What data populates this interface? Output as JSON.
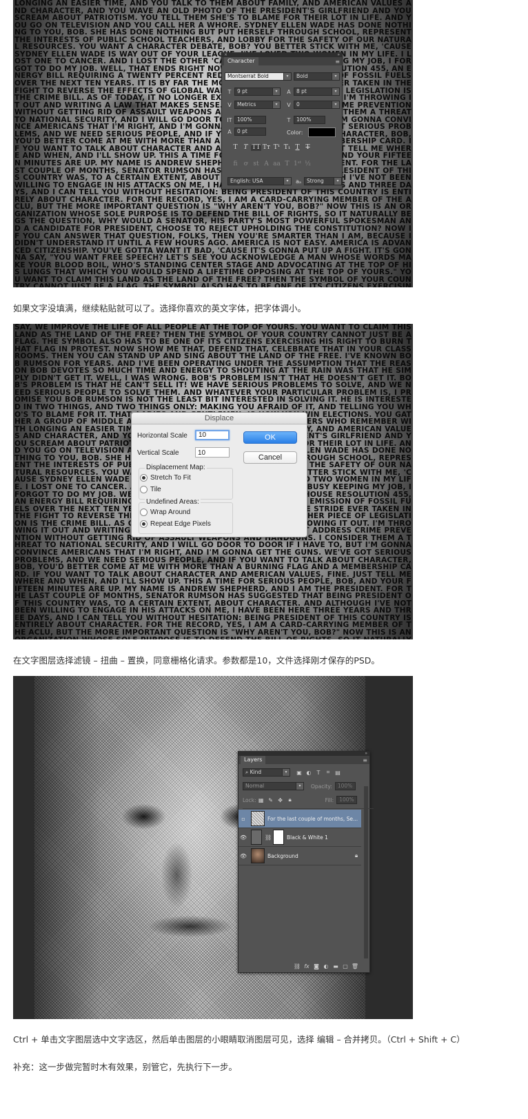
{
  "figure1": {
    "art_text": "LONGING AN EASIER TIME, AND YOU TALK TO THEM ABOUT FAMILY, AND AMERICAN VALUES AND CHARACTER, AND YOU WAVE AN OLD PHOTO OF THE PRESIDENT'S GIRLFRIEND AND YOU SCREAM ABOUT PATRIOTISM. YOU TELL THEM SHE'S TO BLAME FOR THEIR LOT IN LIFE. AND YOU GO ON TELEVISION AND YOU CALL HER A WHORE. SYDNEY ELLEN WADE HAS DONE NOTHING TO YOU, BOB. SHE HAS DONE NOTHING BUT PUT HERSELF THROUGH SCHOOL, REPRESENT THE INTERESTS OF PUBLIC SCHOOL TEACHERS, AND LOBBY FOR THE SAFETY OF OUR NATURAL RESOURCES. YOU WANT A CHARACTER DEBATE, BOB? YOU BETTER STICK WITH ME, 'CAUSE SYDNEY ELLEN WADE IS WAY OUT OF YOUR LEAGUE. I'VE LOVED TWO WOMEN IN MY LIFE. I LOST ONE TO CANCER. AND I LOST THE OTHER 'CAUSE I WAS SO BUSY KEEPING MY JOB, I FORGOT TO DO MY JOB. WELL, THAT ENDS RIGHT NOW. IT'S WHITE HOUSE RESOLUTION 455, AN ENERGY BILL REQUIRING A TWENTY PERCENT REDUCTION OF THE EMISSION OF FOSSIL FUELS OVER THE NEXT TEN YEARS. IT IS BY FAR THE MOST AGGRESSIVE STRIDE EVER TAKEN IN THE FIGHT TO REVERSE THE EFFECTS OF GLOBAL WARMING. THE OTHER PIECE OF LEGISLATION IS THE CRIME BILL. AS OF TODAY, IT NO LONGER EXISTS. I'M THROWING IT OUT. I'M THROWING IT OUT AND WRITING A LAW THAT MAKES SENSE. YOU CANNOT ADDRESS CRIME PREVENTION WITHOUT GETTING RID OF ASSAULT WEAPONS AND HANDGUNS. I CONSIDER THEM A THREAT TO NATIONAL SECURITY, AND I WILL GO DOOR TO DOOR IF I HAVE TO, BUT I'M GONNA CONVINCE AMERICANS THAT I'M RIGHT, AND I'M GONNA GET THE GUNS. WE'VE GOT SERIOUS PROBLEMS, AND WE NEED SERIOUS PEOPLE, AND IF YOU WANT TO TALK ABOUT CHARACTER, BOB, YOU'D BETTER COME AT ME WITH MORE THAN A BURNING FLAG AND A MEMBERSHIP CARD. IF YOU WANT TO TALK ABOUT CHARACTER AND AMERICAN VALUES, FINE. JUST TELL ME WHERE AND WHEN, AND I'LL SHOW UP. THIS A TIME FOR SERIOUS PEOPLE, BOB, AND YOUR FIFTEEN MINUTES ARE UP. MY NAME IS ANDREW SHEPHERD, AND I AM THE PRESIDENT. FOR THE LAST COUPLE OF MONTHS, SENATOR RUMSON HAS SUGGESTED THAT BEING PRESIDENT OF THIS COUNTRY WAS, TO A CERTAIN EXTENT, ABOUT CHARACTER. AND ALTHOUGH I'VE NOT BEEN WILLING TO ENGAGE IN HIS ATTACKS ON ME, I HAVE BEEN HERE THREE YEARS AND THREE DAYS, AND I CAN TELL YOU WITHOUT HESITATION: BEING PRESIDENT OF THIS COUNTRY IS ENTIRELY ABOUT CHARACTER. FOR THE RECORD, YES, I AM A CARD-CARRYING MEMBER OF THE ACLU, BUT THE MORE IMPORTANT QUESTION IS \"WHY AREN'T YOU, BOB?\" NOW THIS IS AN ORGANIZATION WHOSE SOLE PURPOSE IS TO DEFEND THE BILL OF RIGHTS, SO IT NATURALLY BEGS THE QUESTION, WHY WOULD A SENATOR, HIS PARTY'S MOST POWERFUL SPOKESMAN AND A CANDIDATE FOR PRESIDENT, CHOOSE TO REJECT UPHOLDING THE CONSTITUTION? NOW IF YOU CAN ANSWER THAT QUESTION, FOLKS, THEN YOU'RE SMARTER THAN I AM, BECAUSE I DIDN'T UNDERSTAND IT UNTIL A FEW HOURS AGO. AMERICA IS NOT EASY. AMERICA IS ADVANCED CITIZENSHIP. YOU'VE GOTTA WANT IT BAD, 'CAUSE IT'S GONNA PUT UP A FIGHT. IT'S GONNA SAY, \"YOU WANT FREE SPEECH? LET'S SEE YOU ACKNOWLEDGE A MAN WHOSE WORDS MAKE YOUR BLOOD BOIL, WHO'S STANDING CENTER STAGE AND ADVOCATING AT THE TOP OF HIS LUNGS THAT WHICH YOU WOULD SPEND A LIFETIME OPPOSING AT THE TOP OF YOURS.\" YOU WANT TO CLAIM THIS LAND AS THE LAND OF THE FREE? THEN THE SYMBOL OF YOUR COUNTRY CANNOT JUST BE A FLAG. THE SYMBOL ALSO HAS TO BE ONE OF ITS CITIZENS EXERCISING HIS RIGHT TO BURN THAT FLAG IN PROTEST. NOW SHOW ME THAT, DEFEND THAT, CELEBRATE THAT IN YOUR CLASSROOMS. THEN YOU CAN STAND UP AND SING ABOUT THE LAND OF THE FREE. I'VE KNOWN BOB RUMSON FOR YEARS. AND I'VE BEEN OPERATING UNDER THE ASSUMPTION THAT THE REASON BOB DEVOTES SO MUCH TIME AND ENERGY TO SHOUTING AT THE RAIN WAS THAT HE SIMPLY DIDN'T GET IT. WELL, I WAS WRONG. BOB'S PROBLEM ISN'T THAT HE DOESN'T GET IT. BOB'S PROBLEM IS THAT HE CAN'T SELL IT! WE HAVE SERIOUS PROBLEMS TO SOLVE, AND WE NEED SERIOUS PEOPLE TO SOLVE THEM. AND WHATEVER YOUR PARTICULAR PROBLEM IS, I PROMISE YOU BOB RUMSON IS NOT THE LEAST BIT INTERESTED IN SOLVING IT. HE IS INTERESTED IN TWO THINGS, AND TWO THINGS ONLY: MAKING YOU AFRAID OF IT, AND TELLING YOU WHO'S TO BLAME FOR IT. THAT, LADIES AND GENTLEMEN, IS HOW YOU WIN ELECTIONS.",
    "character_panel": {
      "tab": "Character",
      "font_family": "Montserrat Bold",
      "font_style": "Bold",
      "font_size": "9 pt",
      "leading": "8 pt",
      "kerning": "Metrics",
      "tracking": "0",
      "vertical_scale": "100%",
      "horizontal_scale": "100%",
      "baseline_shift": "0 pt",
      "color_label": "Color:",
      "language": "English: USA",
      "aa_label": "aₐ",
      "antialias": "Strong"
    }
  },
  "caption1": "如果文字没填满，继续粘贴就可以了。选择你喜欢的英文字体，把字体调小。",
  "figure2": {
    "art_text": "SAY, WE IMPROVE THE LIFE OF ALL PEOPLE AT THE TOP OF YOURS. YOU WANT TO CLAIM THIS LAND AS THE LAND OF THE FREE? THEN THE SYMBOL OF YOUR COUNTRY CANNOT JUST BE A FLAG. THE SYMBOL ALSO HAS TO BE ONE OF ITS CITIZENS EXERCISING HIS RIGHT TO BURN THAT FLAG IN PROTEST. NOW SHOW ME THAT, DEFEND THAT, CELEBRATE THAT IN YOUR CLASSROOMS. THEN YOU CAN STAND UP AND SING ABOUT THE LAND OF THE FREE. I'VE KNOWN BOB RUMSON FOR YEARS. AND I'VE BEEN OPERATING UNDER THE ASSUMPTION THAT THE REASON BOB DEVOTES SO MUCH TIME AND ENERGY TO SHOUTING AT THE RAIN WAS THAT HE SIMPLY DIDN'T GET IT. WELL, I WAS WRONG. BOB'S PROBLEM ISN'T THAT HE DOESN'T GET IT. BOB'S PROBLEM IS THAT HE CAN'T SELL IT! WE HAVE SERIOUS PROBLEMS TO SOLVE, AND WE NEED SERIOUS PEOPLE TO SOLVE THEM. AND WHATEVER YOUR PARTICULAR PROBLEM IS, I PROMISE YOU BOB RUMSON IS NOT THE LEAST BIT INTERESTED IN SOLVING IT. HE IS INTERESTED IN TWO THINGS, AND TWO THINGS ONLY: MAKING YOU AFRAID OF IT, AND TELLING YOU WHO'S TO BLAME FOR IT. THAT, LADIES AND GENTLEMEN, IS HOW YOU WIN ELECTIONS. YOU GATHER A GROUP OF MIDDLE AGE, MIDDLE CLASS, MIDDLE INCOME VOTERS WHO REMEMBER WITH LONGING AN EASIER TIME, AND YOU TALK TO THEM ABOUT FAMILY, AND AMERICAN VALUES AND CHARACTER, AND YOU WAVE AN OLD PHOTO OF THE PRESIDENT'S GIRLFRIEND AND YOU SCREAM ABOUT PATRIOTISM. YOU TELL THEM SHE'S TO BLAME FOR THEIR LOT IN LIFE. AND YOU GO ON TELEVISION AND YOU CALL HER A WHORE. SYDNEY ELLEN WADE HAS DONE NOTHING TO YOU, BOB. SHE HAS DONE NOTHING BUT PUT HERSELF THROUGH SCHOOL, REPRESENT THE INTERESTS OF PUBLIC SCHOOL TEACHERS, AND LOBBY FOR THE SAFETY OF OUR NATURAL RESOURCES. YOU WANT A CHARACTER DEBATE, BOB? YOU BETTER STICK WITH ME, 'CAUSE SYDNEY ELLEN WADE IS WAY OUT OF YOUR LEAGUE. I'VE LOVED TWO WOMEN IN MY LIFE. I LOST ONE TO CANCER. AND I LOST THE OTHER 'CAUSE I WAS SO BUSY KEEPING MY JOB, I FORGOT TO DO MY JOB. WELL, THAT ENDS RIGHT NOW. IT'S WHITE HOUSE RESOLUTION 455, AN ENERGY BILL REQUIRING A TWENTY PERCENT REDUCTION OF THE EMISSION OF FOSSIL FUELS OVER THE NEXT TEN YEARS. IT IS BY FAR THE MOST AGGRESSIVE STRIDE EVER TAKEN IN THE FIGHT TO REVERSE THE EFFECTS OF GLOBAL WARMING. THE OTHER PIECE OF LEGISLATION IS THE CRIME BILL. AS OF TODAY, IT NO LONGER EXISTS. I'M THROWING IT OUT. I'M THROWING IT OUT AND WRITING A LAW THAT MAKES SENSE. YOU CANNOT ADDRESS CRIME PREVENTION WITHOUT GETTING RID OF ASSAULT WEAPONS AND HANDGUNS. I CONSIDER THEM A THREAT TO NATIONAL SECURITY, AND I WILL GO DOOR TO DOOR IF I HAVE TO, BUT I'M GONNA CONVINCE AMERICANS THAT I'M RIGHT, AND I'M GONNA GET THE GUNS. WE'VE GOT SERIOUS PROBLEMS, AND WE NEED SERIOUS PEOPLE, AND IF YOU WANT TO TALK ABOUT CHARACTER, BOB, YOU'D BETTER COME AT ME WITH MORE THAN A BURNING FLAG AND A MEMBERSHIP CARD. IF YOU WANT TO TALK ABOUT CHARACTER AND AMERICAN VALUES, FINE. JUST TELL ME WHERE AND WHEN, AND I'LL SHOW UP. THIS A TIME FOR SERIOUS PEOPLE, BOB, AND YOUR FIFTEEN MINUTES ARE UP. MY NAME IS ANDREW SHEPHERD, AND I AM THE PRESIDENT. FOR THE LAST COUPLE OF MONTHS, SENATOR RUMSON HAS SUGGESTED THAT BEING PRESIDENT OF THIS COUNTRY WAS, TO A CERTAIN EXTENT, ABOUT CHARACTER. AND ALTHOUGH I'VE NOT BEEN WILLING TO ENGAGE IN HIS ATTACKS ON ME, I HAVE BEEN HERE THREE YEARS AND THREE DAYS, AND I CAN TELL YOU WITHOUT HESITATION: BEING PRESIDENT OF THIS COUNTRY IS ENTIRELY ABOUT CHARACTER. FOR THE RECORD, YES, I AM A CARD-CARRYING MEMBER OF THE ACLU, BUT THE MORE IMPORTANT QUESTION IS \"WHY AREN'T YOU, BOB?\" NOW THIS IS AN ORGANIZATION WHOSE SOLE PURPOSE IS TO DEFEND THE BILL OF RIGHTS, SO IT NATURALLY BEGS THE QUESTION, WHY WOULD A SENATOR, HIS PARTY'S MOST POWERFUL SPOKESMAN AND A CANDIDATE FOR PRESIDENT, CHOOSE TO REJECT UPHOLDING THE CONSTITUTION? NOW IF YOU CAN ANSWER THAT QUESTION, FOLKS, THEN YOU'RE SMARTER THAN I AM, BECAUSE I DIDN'T UNDERSTAND IT UNTIL A FEW HOURS AGO. AMERICA ISN'T EASY. AMERICA IS ADVANCED CITIZENSHIP. YOU'VE GOTTA WANT IT BAD, 'CAUSE IT'S GONNA PUT UP A FIGHT. IT'S GONNA SAY \"YOU WANT FREE SPEECH? LET'S SEE YOU ACKNOWLEDGE A MAN WHOSE WORDS",
    "dialog": {
      "title": "Displace",
      "horizontal_scale_label": "Horizontal Scale",
      "horizontal_scale_value": "10",
      "vertical_scale_label": "Vertical Scale",
      "vertical_scale_value": "10",
      "ok": "OK",
      "cancel": "Cancel",
      "displacement_map_label": "Displacement Map:",
      "stretch_to_fit": "Stretch To Fit",
      "tile": "Tile",
      "undefined_areas_label": "Undefined Areas:",
      "wrap_around": "Wrap Around",
      "repeat_edge_pixels": "Repeat Edge Pixels"
    }
  },
  "caption2": "在文字图层选择滤镜 – 扭曲 – 置换，同意栅格化请求。参数都是10，文件选择刚才保存的PSD。",
  "figure3": {
    "layers_panel": {
      "tab": "Layers",
      "kind_label": "Kind",
      "blend_mode": "Normal",
      "opacity_label": "Opacity:",
      "opacity_value": "100%",
      "lock_label": "Lock:",
      "fill_label": "Fill:",
      "fill_value": "100%",
      "layers": [
        {
          "name": "For the last couple of months, Se...",
          "selected": true
        },
        {
          "name": "Black & White 1",
          "selected": false
        },
        {
          "name": "Background",
          "selected": false
        }
      ]
    }
  },
  "caption3": "Ctrl + 单击文字图层选中文字选区，然后单击图层的小眼睛取消图层可见，选择 编辑 – 合并拷贝。（Ctrl + Shift + C）",
  "caption4": "补充：这一步做完暂时木有效果，别管它，先执行下一步。"
}
